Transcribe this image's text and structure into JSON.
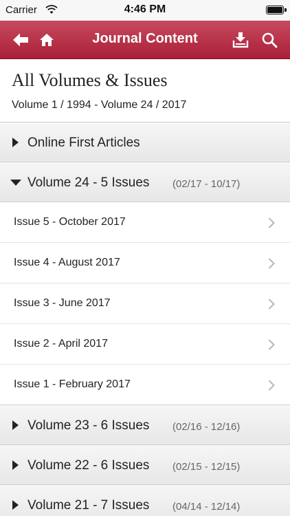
{
  "status_bar": {
    "carrier": "Carrier",
    "time": "4:46 PM"
  },
  "nav": {
    "title": "Journal Content",
    "icons": [
      "back-arrow-icon",
      "home-icon",
      "download-icon",
      "search-icon"
    ]
  },
  "header": {
    "title": "All Volumes & Issues",
    "subtitle": "Volume 1 / 1994 - Volume 24 / 2017"
  },
  "list": {
    "online_first": "Online First Articles",
    "volume24": {
      "label": "Volume 24 - 5 Issues",
      "range": "(02/17 - 10/17)",
      "expanded": true,
      "issues": [
        "Issue 5 - October 2017",
        "Issue 4 - August 2017",
        "Issue 3 - June 2017",
        "Issue 2 - April 2017",
        "Issue 1 - February 2017"
      ]
    },
    "volume23": {
      "label": "Volume 23 - 6 Issues",
      "range": "(02/16 - 12/16)"
    },
    "volume22": {
      "label": "Volume 22 - 6 Issues",
      "range": "(02/15 - 12/15)"
    },
    "volume21": {
      "label": "Volume 21 - 7 Issues",
      "range": "(04/14 - 12/14)"
    }
  },
  "colors": {
    "nav_bar": "#b5283f",
    "row_gradient": "#eeeeee"
  }
}
